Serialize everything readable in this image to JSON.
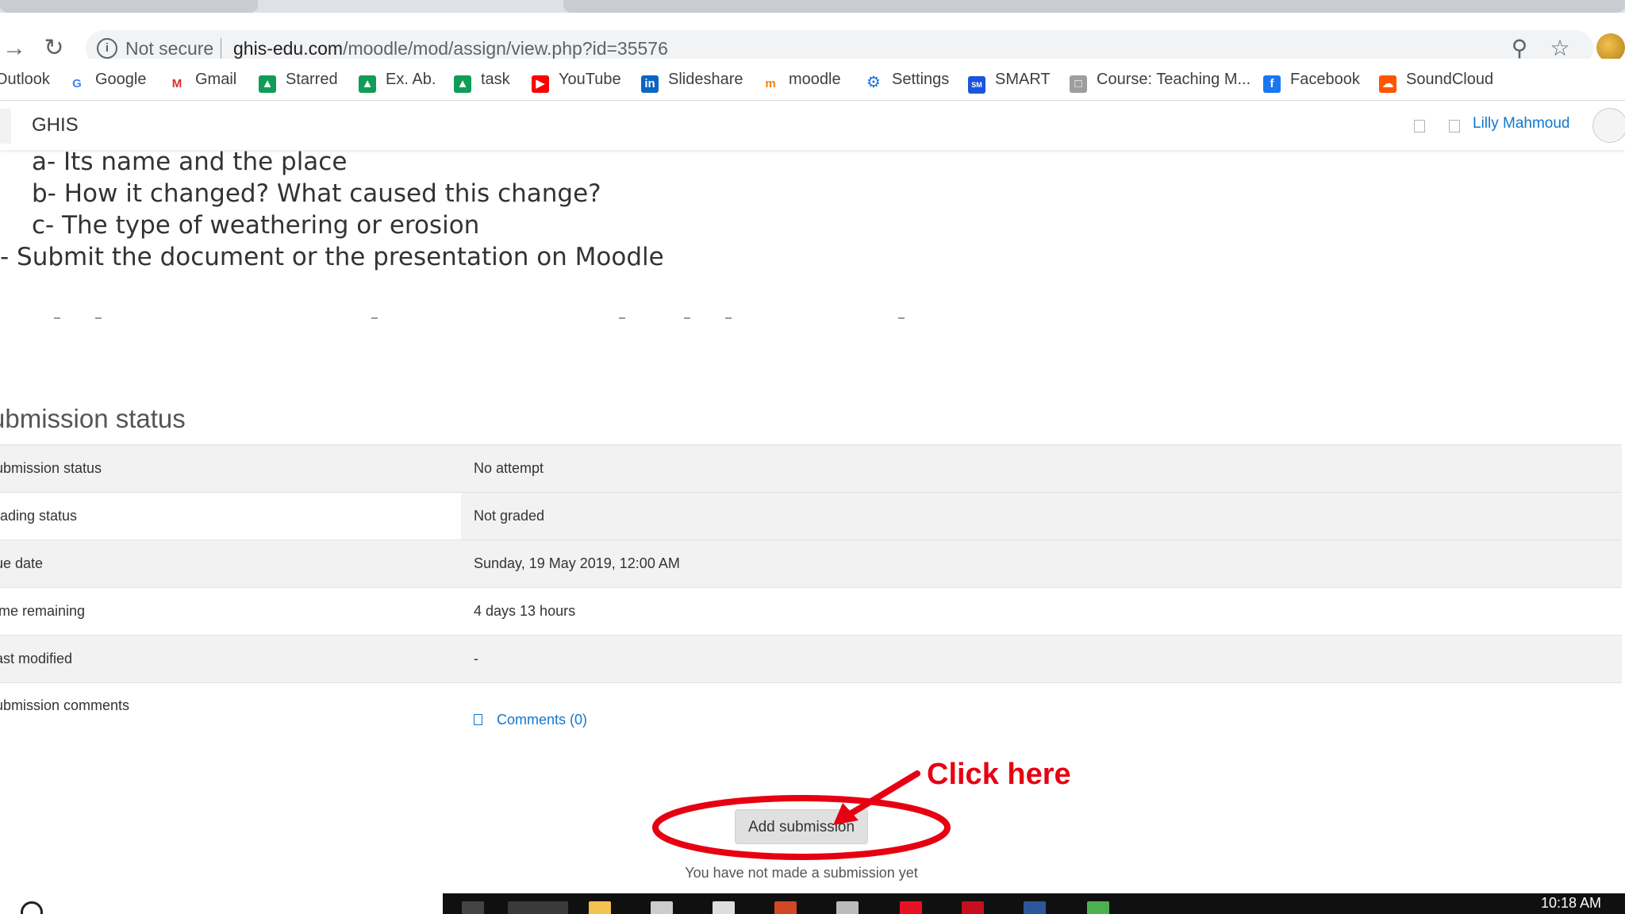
{
  "browser": {
    "security_label": "Not secure",
    "url_host": "ghis-edu.com",
    "url_path": "/moodle/mod/assign/view.php?id=35576",
    "bookmarks": [
      {
        "label": "Outlook",
        "icon": "outlook-icon",
        "color": "#0078d4"
      },
      {
        "label": "Google",
        "icon": "google-icon",
        "color": "#4285f4"
      },
      {
        "label": "Gmail",
        "icon": "gmail-icon",
        "color": "#d93025"
      },
      {
        "label": "Starred",
        "icon": "drive-icon",
        "color": "#0f9d58"
      },
      {
        "label": "Ex. Ab.",
        "icon": "drive-icon",
        "color": "#0f9d58"
      },
      {
        "label": "task",
        "icon": "drive-icon",
        "color": "#0f9d58"
      },
      {
        "label": "YouTube",
        "icon": "youtube-icon",
        "color": "#ff0000"
      },
      {
        "label": "Slideshare",
        "icon": "linkedin-icon",
        "color": "#0a66c2"
      },
      {
        "label": "moodle",
        "icon": "moodle-icon",
        "color": "#f98012"
      },
      {
        "label": "Settings",
        "icon": "gear-icon",
        "color": "#1a73e8"
      },
      {
        "label": "SMART",
        "icon": "smart-icon",
        "color": "#1a56db"
      },
      {
        "label": "Course: Teaching M...",
        "icon": "page-icon",
        "color": "#9e9e9e"
      },
      {
        "label": "Facebook",
        "icon": "facebook-icon",
        "color": "#1877f2"
      },
      {
        "label": "SoundCloud",
        "icon": "soundcloud-icon",
        "color": "#ff5500"
      }
    ]
  },
  "moodle": {
    "site_name": "GHIS",
    "user_name": "Lilly Mahmoud"
  },
  "intro": {
    "line_a": "a- Its name and the place",
    "line_b": "b- How it changed? What caused this change?",
    "line_c": "c- The type of weathering or erosion",
    "line_submit": "- Submit the document or the presentation on Moodle"
  },
  "submission": {
    "heading": "ubmission status",
    "rows": [
      {
        "label": "ubmission status",
        "value": "No attempt"
      },
      {
        "label": "rading status",
        "value": "Not graded"
      },
      {
        "label": "ue date",
        "value": "Sunday, 19 May 2019, 12:00 AM"
      },
      {
        "label": "ime remaining",
        "value": "4 days 13 hours"
      },
      {
        "label": "ast modified",
        "value": "-"
      },
      {
        "label": "ubmission comments",
        "value": "Comments (0)"
      }
    ],
    "button_label": "Add submission",
    "note": "You have not made a submission yet"
  },
  "annotation": {
    "text": "Click here",
    "color": "#e60012"
  },
  "taskbar": {
    "clock": "10:18 AM"
  }
}
